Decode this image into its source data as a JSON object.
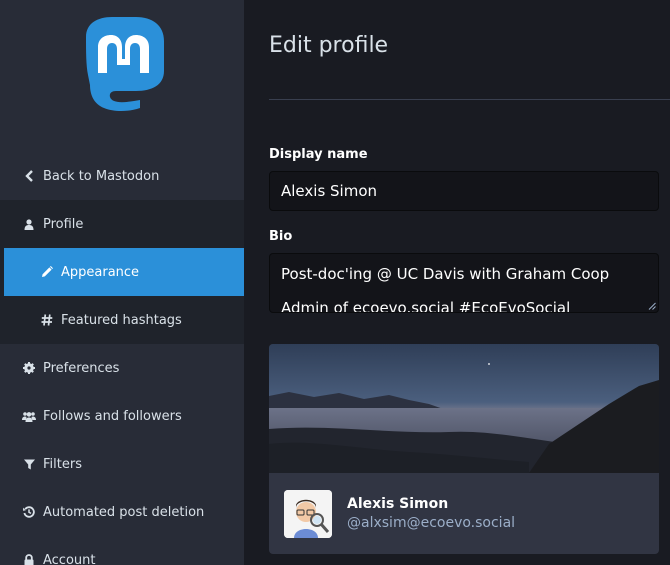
{
  "app": {
    "logo_icon": "mastodon-logo",
    "accent": "#2b90d9"
  },
  "sidebar": {
    "back": {
      "label": "Back to Mastodon",
      "icon": "chevron-left-icon"
    },
    "items": [
      {
        "label": "Profile",
        "icon": "user-icon"
      },
      {
        "label": "Appearance",
        "icon": "pencil-icon",
        "active": true
      },
      {
        "label": "Featured hashtags",
        "icon": "hashtag-icon"
      },
      {
        "label": "Preferences",
        "icon": "gear-icon"
      },
      {
        "label": "Follows and followers",
        "icon": "users-icon"
      },
      {
        "label": "Filters",
        "icon": "filter-icon"
      },
      {
        "label": "Automated post deletion",
        "icon": "history-icon"
      },
      {
        "label": "Account",
        "icon": "lock-icon"
      }
    ]
  },
  "main": {
    "title": "Edit profile",
    "display_name": {
      "label": "Display name",
      "value": "Alexis Simon"
    },
    "bio": {
      "label": "Bio",
      "lines": [
        "Post-doc'ing @ UC Davis with Graham Coop",
        "Admin of ecoevo.social #EcoEvoSocial"
      ]
    },
    "preview": {
      "name": "Alexis Simon",
      "handle": "@alxsim@ecoevo.social"
    }
  }
}
